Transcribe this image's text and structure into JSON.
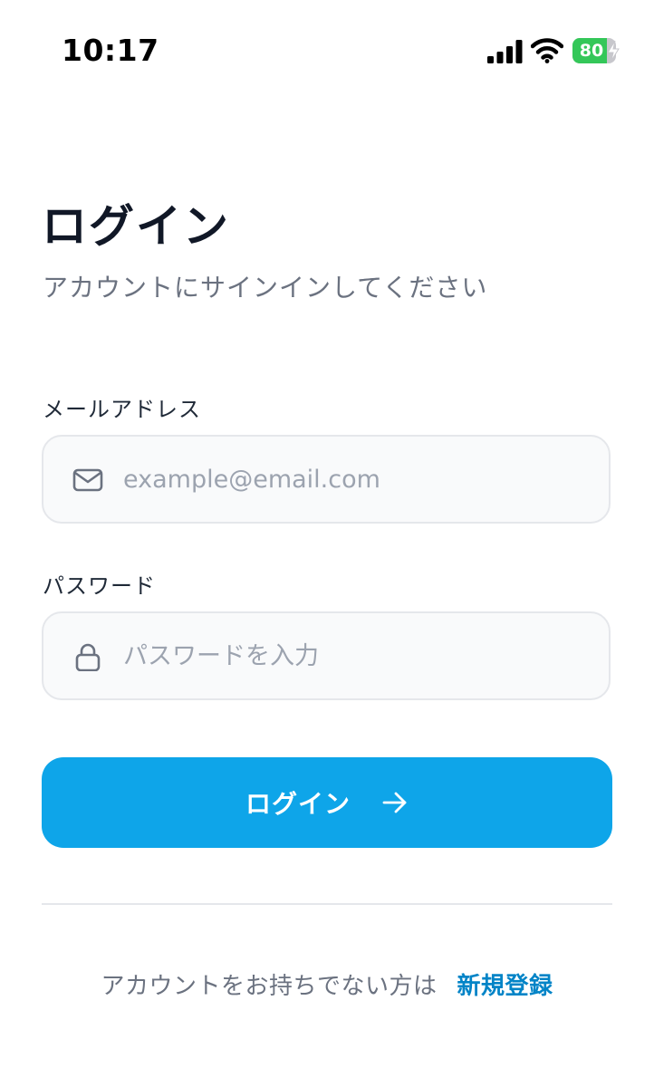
{
  "status_bar": {
    "time": "10:17",
    "battery_level": "80",
    "battery_fraction": 0.8,
    "icons": [
      "cellular-signal-icon",
      "wifi-icon",
      "battery-icon",
      "charging-bolt-icon"
    ]
  },
  "header": {
    "title": "ログイン",
    "subtitle": "アカウントにサインインしてください"
  },
  "form": {
    "email": {
      "label": "メールアドレス",
      "placeholder": "example@email.com",
      "value": "",
      "icon": "mail-icon"
    },
    "password": {
      "label": "パスワード",
      "placeholder": "パスワードを入力",
      "value": "",
      "icon": "lock-icon"
    },
    "submit": {
      "label": "ログイン",
      "icon": "arrow-right-icon"
    }
  },
  "footer": {
    "prompt": "アカウントをお持ちでない方は",
    "signup_link": "新規登録"
  },
  "colors": {
    "primary": "#0ea5e9",
    "link": "#0284c7",
    "battery_green": "#34c759",
    "title": "#111827",
    "muted": "#6b7280"
  }
}
